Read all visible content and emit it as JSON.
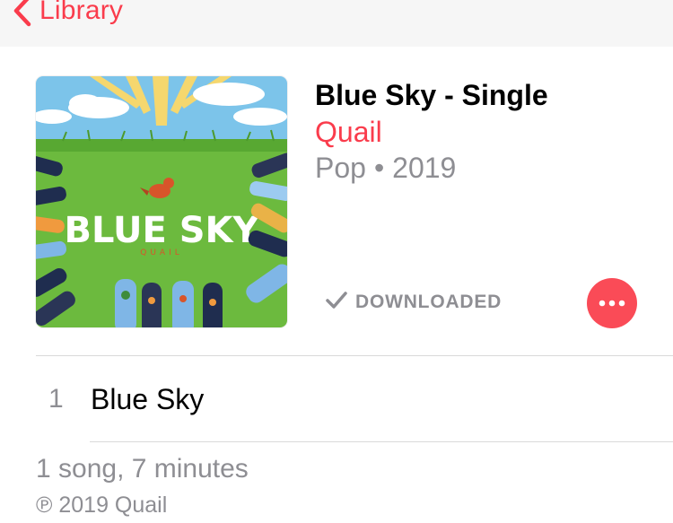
{
  "nav": {
    "back_label": "Library",
    "back_icon": "chevron-left-icon"
  },
  "album": {
    "title": "Blue Sky - Single",
    "artist": "Quail",
    "genre": "Pop",
    "separator": "•",
    "year": "2019",
    "status_label": "DOWNLOADED",
    "status_icon": "checkmark-icon",
    "more_icon": "ellipsis-icon",
    "artwork": {
      "title_text": "BLUE SKY",
      "subtitle_text": "QUAIL"
    }
  },
  "tracks": [
    {
      "number": "1",
      "title": "Blue Sky"
    }
  ],
  "footer": {
    "summary": "1 song, 7 minutes",
    "copyright": "℗ 2019 Quail"
  },
  "colors": {
    "accent": "#fa3c4c",
    "secondary_text": "#8e8e93",
    "more_button": "#fa4b57"
  }
}
